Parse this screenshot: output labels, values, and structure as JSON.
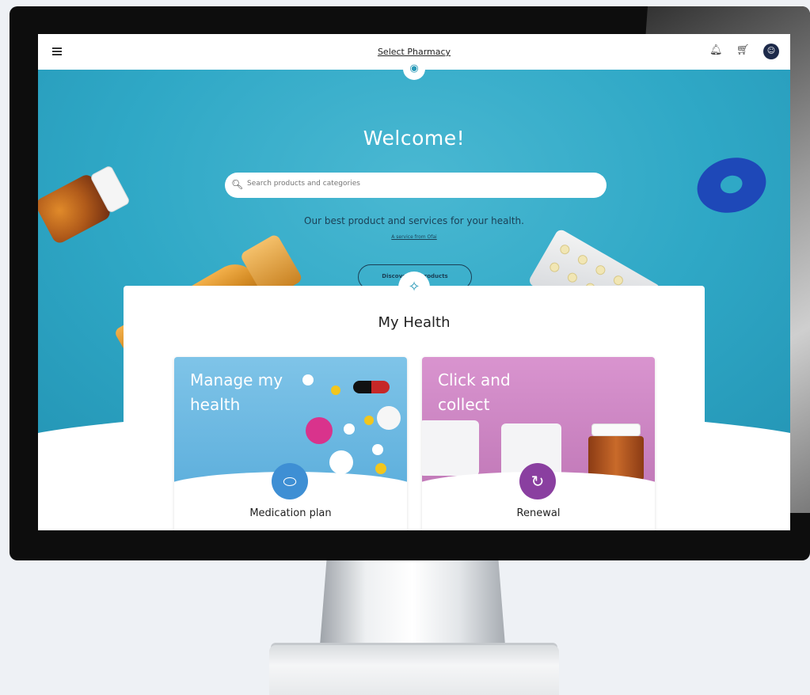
{
  "topbar": {
    "title": "Select Pharmacy",
    "menu_icon": "hamburger-menu-icon",
    "bell_icon": "bell-icon",
    "cart_icon": "cart-icon",
    "avatar_icon": "user-avatar-icon"
  },
  "hero": {
    "welcome": "Welcome!",
    "search_placeholder": "Search products and categories",
    "tagline": "Our best product and services for your health.",
    "service_link": "A service from Ofai",
    "discover_button": "Discover all products"
  },
  "health": {
    "title": "My Health",
    "tiles": [
      {
        "heading": "Manage my health",
        "label": "Medication plan",
        "icon": "pill-icon"
      },
      {
        "heading": "Click and collect",
        "label": "Renewal",
        "icon": "prescription-renew-icon"
      }
    ]
  },
  "colors": {
    "hero_blue": "#2fa8c6",
    "avatar_navy": "#1d2a4a",
    "tile1_icon": "#3e8fd4",
    "tile2_icon": "#8a3fa0"
  }
}
